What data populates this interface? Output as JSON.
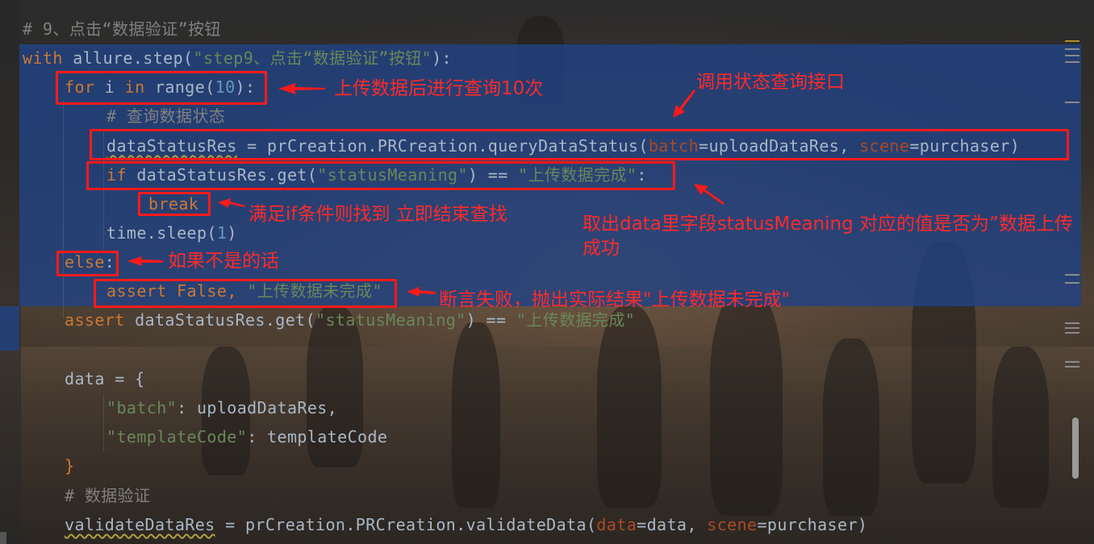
{
  "editor": {
    "lines": {
      "l1": [
        {
          "t": "# 9、点击“数据验证”按钮",
          "c": "cmt"
        }
      ],
      "l2": [
        {
          "t": "with",
          "c": "kw"
        },
        {
          "t": " allure.step(",
          "c": "fn"
        },
        {
          "t": "\"step9、点击“数据验证”按钮\"",
          "c": "str"
        },
        {
          "t": "):",
          "c": "fn"
        }
      ],
      "l3": [
        {
          "t": "for",
          "c": "kw"
        },
        {
          "t": " i ",
          "c": "fn"
        },
        {
          "t": "in",
          "c": "kw"
        },
        {
          "t": " range(",
          "c": "fn"
        },
        {
          "t": "10",
          "c": "num"
        },
        {
          "t": "):",
          "c": "fn"
        }
      ],
      "l4": [
        {
          "t": "# 查询数据状态",
          "c": "cmt"
        }
      ],
      "l5": [
        {
          "t": "dataStatusRes",
          "c": "fn und"
        },
        {
          "t": " = prCreation.PRCreation.queryDataStatus(",
          "c": "fn"
        },
        {
          "t": "batch",
          "c": "par"
        },
        {
          "t": "=uploadDataRes, ",
          "c": "fn"
        },
        {
          "t": "scene",
          "c": "par"
        },
        {
          "t": "=purchaser)",
          "c": "fn"
        }
      ],
      "l6": [
        {
          "t": "if",
          "c": "kw"
        },
        {
          "t": " dataStatusRes.get(",
          "c": "fn"
        },
        {
          "t": "\"statusMeaning\"",
          "c": "str"
        },
        {
          "t": ") == ",
          "c": "fn"
        },
        {
          "t": "\"上传数据完成\"",
          "c": "str"
        },
        {
          "t": ":",
          "c": "fn"
        }
      ],
      "l7": [
        {
          "t": "break",
          "c": "kw"
        }
      ],
      "l8": [
        {
          "t": "time.sleep(",
          "c": "fn"
        },
        {
          "t": "1",
          "c": "num"
        },
        {
          "t": ")",
          "c": "fn"
        }
      ],
      "l9": [
        {
          "t": "else",
          "c": "kw"
        },
        {
          "t": ":",
          "c": "fn"
        }
      ],
      "l10": [
        {
          "t": "assert",
          "c": "kw"
        },
        {
          "t": " ",
          "c": "fn"
        },
        {
          "t": "False",
          "c": "kw"
        },
        {
          "t": ", ",
          "c": "kw"
        },
        {
          "t": "\"上传数据未完成\"",
          "c": "str"
        }
      ],
      "l11": [
        {
          "t": "assert",
          "c": "kw"
        },
        {
          "t": " dataStatusRes.get(",
          "c": "fn"
        },
        {
          "t": "\"statusMeaning\"",
          "c": "str"
        },
        {
          "t": ") == ",
          "c": "fn"
        },
        {
          "t": "\"上传数据完成\"",
          "c": "str"
        }
      ],
      "l12": [
        {
          "t": "data = {",
          "c": "fn"
        }
      ],
      "l13": [
        {
          "t": "\"batch\"",
          "c": "str"
        },
        {
          "t": ": uploadDataRes,",
          "c": "fn"
        }
      ],
      "l14": [
        {
          "t": "\"templateCode\"",
          "c": "str"
        },
        {
          "t": ": templateCode",
          "c": "fn"
        }
      ],
      "l15": [
        {
          "t": "}",
          "c": "kw"
        }
      ],
      "l16": [
        {
          "t": "# 数据验证",
          "c": "cmt"
        }
      ],
      "l17": [
        {
          "t": "validateDataRes",
          "c": "fn und"
        },
        {
          "t": " = prCreation.PRCreation.validateData(",
          "c": "fn"
        },
        {
          "t": "data",
          "c": "par"
        },
        {
          "t": "=data, ",
          "c": "fn"
        },
        {
          "t": "scene",
          "c": "par"
        },
        {
          "t": "=purchaser)",
          "c": "fn"
        }
      ]
    }
  },
  "annotations": {
    "loop_note": "上传数据后进行查询10次",
    "api_note": "调用状态查询接口",
    "break_note": "满足if条件则找到 立即结束查找",
    "field_note": "取出data里字段statusMeaning 对应的值是否为”数据上传成功",
    "else_note": "如果不是的话",
    "assert_note": "断言失败，抛出实际结果\"上传数据未完成\""
  },
  "colors": {
    "keyword": "#cc7832",
    "string": "#6a8759",
    "number": "#6897bb",
    "comment": "#808080",
    "parameter": "#aa4926",
    "text": "#a9b7c6",
    "selection": "#214283",
    "annotation_red": "#ff1a1a"
  }
}
